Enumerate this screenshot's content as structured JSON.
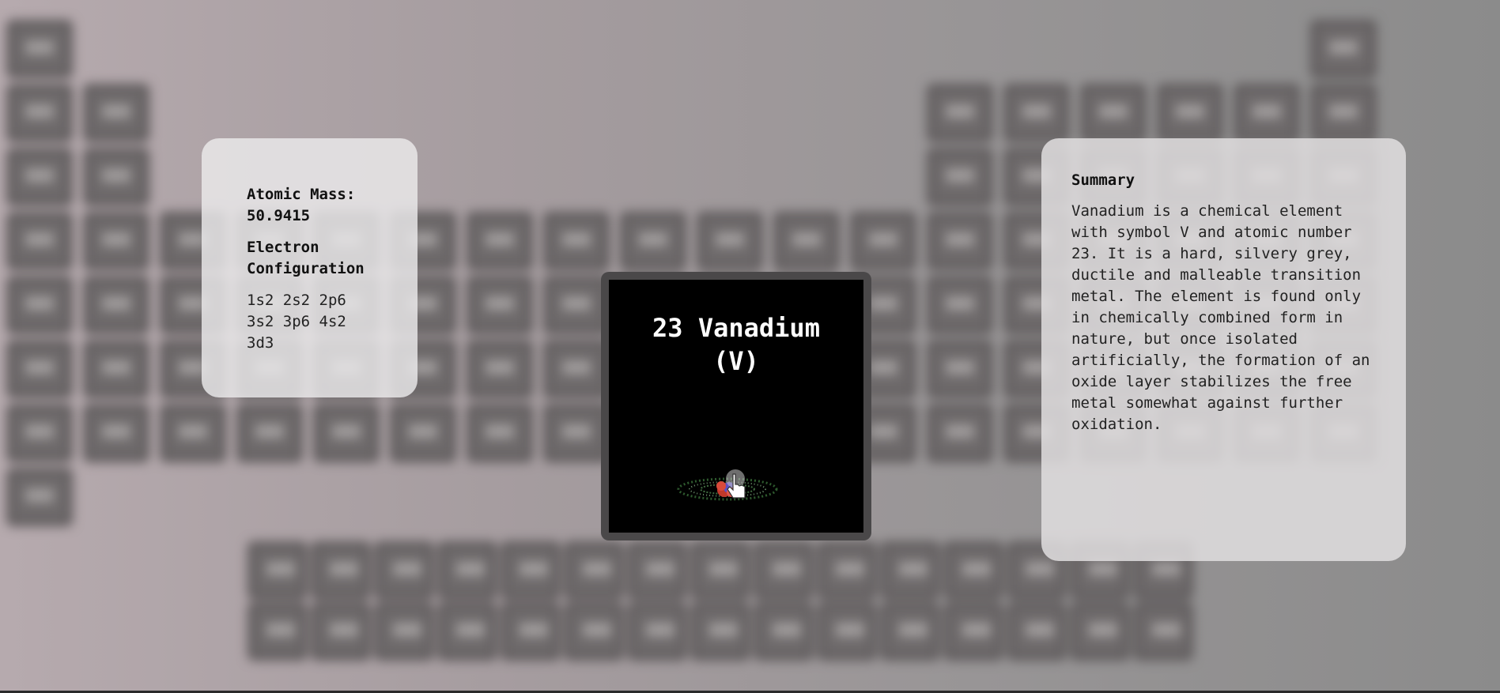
{
  "element": {
    "number": "23",
    "name": "Vanadium",
    "title_line1": "23 Vanadium",
    "title_line2": "(V)"
  },
  "info": {
    "atomic_mass_label": "Atomic Mass:",
    "atomic_mass_value": "50.9415",
    "electron_config_label": "Electron Configuration",
    "electron_config_value": "1s2 2s2 2p6 3s2 3p6 4s2 3d3"
  },
  "summary": {
    "title": "Summary",
    "text": "Vanadium is a chemical element with symbol V and atomic number 23. It is a hard, silvery grey, ductile and malleable transition metal. The element is found only in chemically combined form in nature, but once isolated artificially, the formation of an oxide layer stabilizes the free metal somewhat against further oxidation."
  },
  "icons": {
    "atom": "atom-model-icon",
    "pointer": "hand-pointer-icon"
  },
  "colors": {
    "viewer_bg": "#000000",
    "viewer_frame": "#4a4849",
    "card_bg": "#ecebeb"
  }
}
